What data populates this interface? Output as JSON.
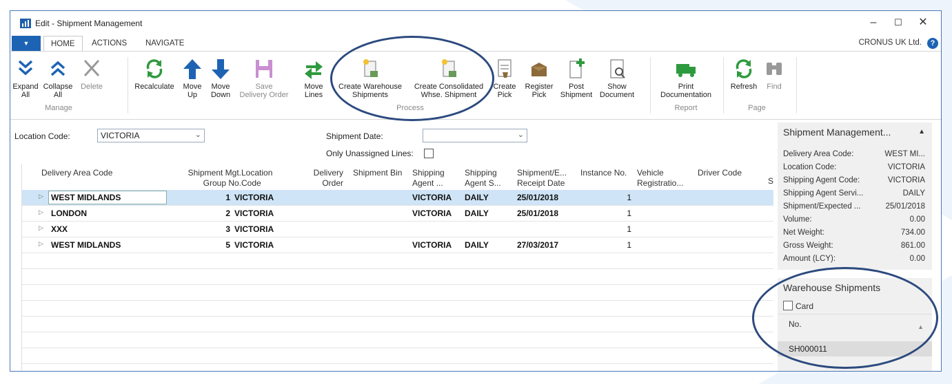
{
  "window": {
    "title": "Edit - Shipment Management"
  },
  "tabs": {
    "home": "HOME",
    "actions": "ACTIONS",
    "navigate": "NAVIGATE",
    "company": "CRONUS UK Ltd.",
    "help": "?"
  },
  "ribbon": {
    "expand_all": [
      "Expand",
      "All"
    ],
    "collapse_all": [
      "Collapse",
      "All"
    ],
    "delete": "Delete",
    "recalculate": "Recalculate",
    "move_up": [
      "Move",
      "Up"
    ],
    "move_down": [
      "Move",
      "Down"
    ],
    "save_delivery_order": [
      "Save",
      "Delivery Order"
    ],
    "move_lines": [
      "Move",
      "Lines"
    ],
    "create_warehouse_shipments": [
      "Create Warehouse",
      "Shipments"
    ],
    "create_consolidated": [
      "Create Consolidated",
      "Whse. Shipment"
    ],
    "create_pick": [
      "Create",
      "Pick"
    ],
    "register_pick": [
      "Register",
      "Pick"
    ],
    "post_shipment": [
      "Post",
      "Shipment"
    ],
    "show_document": [
      "Show",
      "Document"
    ],
    "print_documentation": [
      "Print",
      "Documentation"
    ],
    "refresh": "Refresh",
    "find": "Find",
    "groups": {
      "manage": "Manage",
      "process": "Process",
      "report": "Report",
      "page": "Page"
    }
  },
  "filters": {
    "location_code_label": "Location Code:",
    "location_code_value": "VICTORIA",
    "shipment_date_label": "Shipment Date:",
    "shipment_date_value": "",
    "only_unassigned_label": "Only Unassigned Lines:"
  },
  "grid": {
    "headers": {
      "delivery_area_code": "Delivery Area Code",
      "shipment_mgt_group_no": [
        "Shipment Mgt.",
        "Group No."
      ],
      "location_code": [
        "Location",
        "Code"
      ],
      "delivery_order": [
        "Delivery",
        "Order"
      ],
      "shipment_bin": "Shipment Bin",
      "shipping_agent": [
        "Shipping",
        "Agent ..."
      ],
      "shipping_agent_s": [
        "Shipping",
        "Agent S..."
      ],
      "shipment_receipt_date": [
        "Shipment/E...",
        "Receipt Date"
      ],
      "instance_no": "Instance No.",
      "vehicle_registration": [
        "Vehicle",
        "Registratio..."
      ],
      "driver_code": "Driver Code",
      "s_col": "S"
    },
    "rows": [
      {
        "area": "WEST MIDLANDS",
        "group": "1",
        "location": "VICTORIA",
        "agent": "VICTORIA",
        "service": "DAILY",
        "date": "25/01/2018",
        "instance": "1"
      },
      {
        "area": "LONDON",
        "group": "2",
        "location": "VICTORIA",
        "agent": "VICTORIA",
        "service": "DAILY",
        "date": "25/01/2018",
        "instance": "1"
      },
      {
        "area": "XXX",
        "group": "3",
        "location": "VICTORIA",
        "agent": "",
        "service": "",
        "date": "",
        "instance": "1"
      },
      {
        "area": "WEST MIDLANDS",
        "group": "5",
        "location": "VICTORIA",
        "agent": "VICTORIA",
        "service": "DAILY",
        "date": "27/03/2017",
        "instance": "1"
      }
    ]
  },
  "factbox": {
    "title": "Shipment Management...",
    "rows": [
      {
        "label": "Delivery Area Code:",
        "value": "WEST MI..."
      },
      {
        "label": "Location Code:",
        "value": "VICTORIA"
      },
      {
        "label": "Shipping Agent Code:",
        "value": "VICTORIA"
      },
      {
        "label": "Shipping Agent Servi...",
        "value": "DAILY"
      },
      {
        "label": "Shipment/Expected ...",
        "value": "25/01/2018"
      },
      {
        "label": "Volume:",
        "value": "0.00"
      },
      {
        "label": "Net Weight:",
        "value": "734.00"
      },
      {
        "label": "Gross Weight:",
        "value": "861.00"
      },
      {
        "label": "Amount (LCY):",
        "value": "0.00"
      }
    ]
  },
  "warehouse_shipments": {
    "title": "Warehouse Shipments",
    "card_label": "Card",
    "column_no": "No.",
    "items": [
      "SH000011"
    ]
  },
  "colors": {
    "accent": "#1d63b3",
    "selected_row": "#cfe5f7",
    "annotation": "#2c4a7e"
  }
}
